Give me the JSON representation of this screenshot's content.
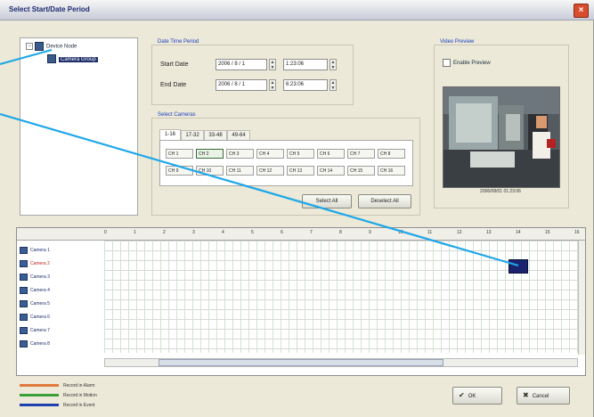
{
  "window": {
    "title": "Select Start/Date Period",
    "close_glyph": "×"
  },
  "tree": {
    "root_label": "Device Node",
    "child_label": "Camera Group",
    "expand_glyph": "−"
  },
  "date_time": {
    "group_label": "Date Time Period",
    "start_label": "Start Date",
    "start_date": "2006 / 8 / 1",
    "start_time": "1:23:06",
    "end_label": "End Date",
    "end_date": "2006 / 8 / 1",
    "end_time": "6:23:06"
  },
  "cameras": {
    "group_label": "Select Cameras",
    "tabs": [
      "1-16",
      "17-32",
      "33-48",
      "49-64"
    ],
    "active_tab": 0,
    "row1": [
      "CH 1",
      "CH 2",
      "CH 3",
      "CH 4",
      "CH 5",
      "CH 6",
      "CH 7",
      "CH 8"
    ],
    "row2": [
      "CH 9",
      "CH 10",
      "CH 11",
      "CH 12",
      "CH 13",
      "CH 14",
      "CH 15",
      "CH 16"
    ],
    "checked": [
      "CH 2"
    ],
    "select_all": "Select All",
    "deselect_all": "Deselect All"
  },
  "preview": {
    "group_label": "Video Preview",
    "enable_label": "Enable Preview",
    "caption": "2006/08/01 01:23:06"
  },
  "timeline": {
    "ticks": [
      "0",
      "1",
      "2",
      "3",
      "4",
      "5",
      "6",
      "7",
      "8",
      "9",
      "10",
      "11",
      "12",
      "13",
      "14",
      "15",
      "16"
    ],
    "cameras": [
      "Camera 1",
      "Camera 2",
      "Camera 3",
      "Camera 4",
      "Camera 5",
      "Camera 6",
      "Camera 7",
      "Camera 8"
    ],
    "highlight_camera": "Camera 2"
  },
  "legend": {
    "items": [
      {
        "label": "Record in Alarm",
        "color": "#e07a3c"
      },
      {
        "label": "Record in Motion",
        "color": "#3aa03a"
      },
      {
        "label": "Record in Event",
        "color": "#1f3fb0"
      }
    ]
  },
  "buttons": {
    "ok": "OK",
    "cancel": "Cancel"
  },
  "callout_color": "#1ea7e8"
}
